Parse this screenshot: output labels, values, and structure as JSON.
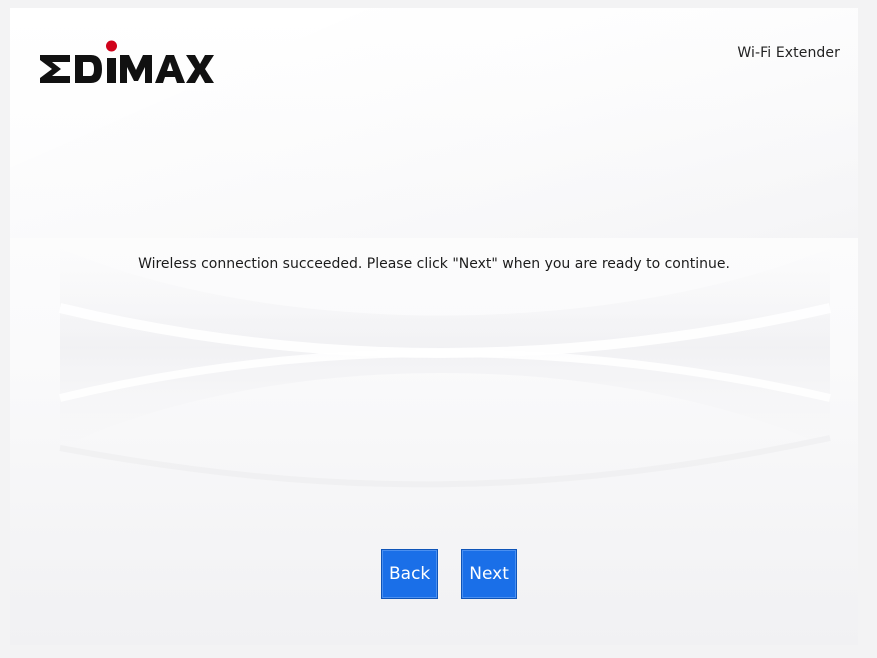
{
  "header": {
    "brand_logo": "EDIMAX",
    "product_name": "Wi-Fi Extender"
  },
  "main": {
    "message": "Wireless connection succeeded. Please click \"Next\" when you are ready to continue."
  },
  "buttons": {
    "back_label": "Back",
    "next_label": "Next"
  },
  "colors": {
    "button_blue": "#1a6fe8",
    "logo_red": "#d0021b",
    "logo_black": "#111111"
  },
  "icons": {
    "logo_dot": "red-dot"
  }
}
